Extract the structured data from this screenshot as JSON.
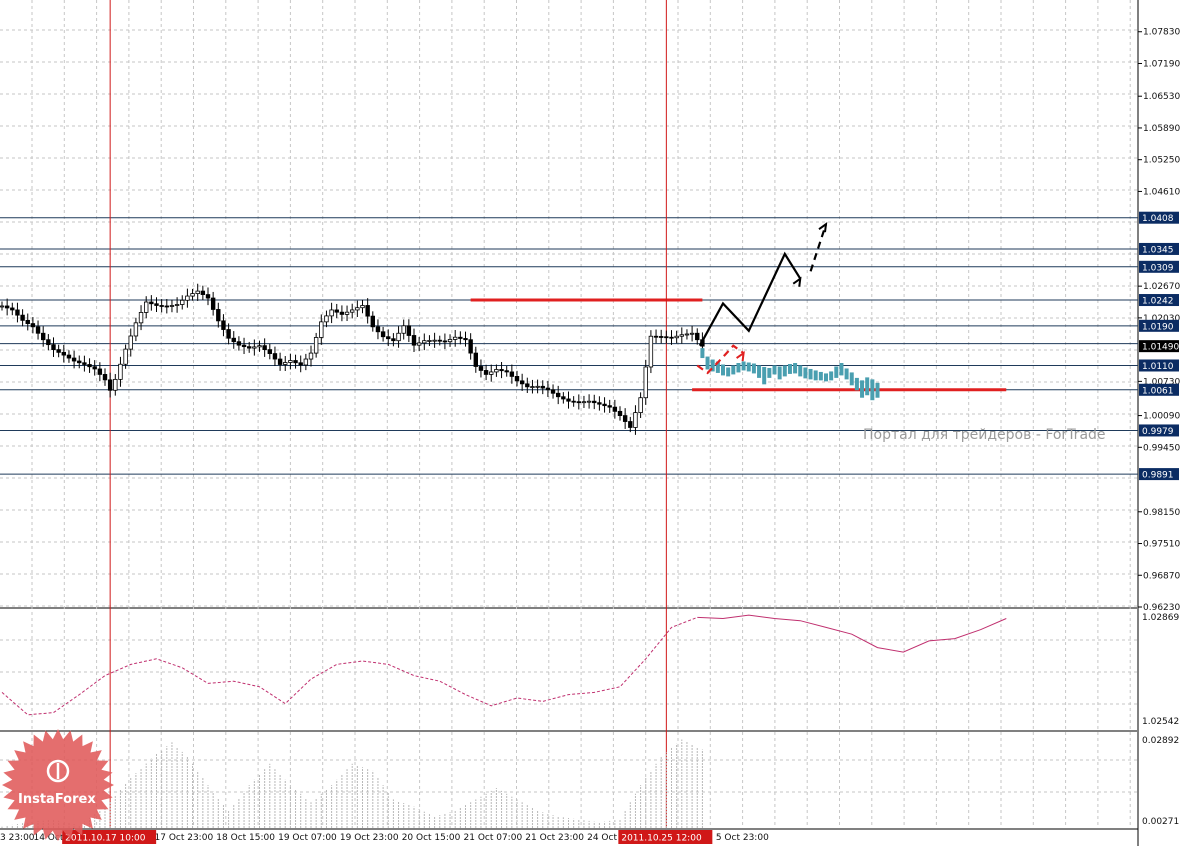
{
  "chart_data": {
    "type": "candlestick",
    "symbol_hint": "",
    "main_pane": {
      "ylim": [
        0.9623,
        1.0847
      ],
      "price_ticks": [
        1.0783,
        1.0719,
        1.0653,
        1.0589,
        1.0525,
        1.0461,
        1.027,
        1.0206,
        1.0078,
        1.0009,
        0.9945,
        0.9815,
        0.9751,
        0.9687,
        0.9623
      ],
      "price_tick_labels": [
        "1.07830",
        "1.07190",
        "1.06530",
        "1.05890",
        "1.05250",
        "1.04610",
        "1.02670",
        "1.02030",
        "1.00730",
        "1.00090",
        "0.99450",
        "0.98150",
        "0.97510",
        "0.96870",
        "0.96230"
      ],
      "current_price": {
        "value": 1.0149,
        "label": "1.01490"
      },
      "horizontal_levels": [
        {
          "value": 1.0408,
          "label": "1.0408"
        },
        {
          "value": 1.0345,
          "label": "1.0345"
        },
        {
          "value": 1.0309,
          "label": "1.0309"
        },
        {
          "value": 1.0242,
          "label": "1.0242"
        },
        {
          "value": 1.019,
          "label": "1.0190"
        },
        {
          "value": 1.011,
          "label": "1.0110"
        },
        {
          "value": 1.0061,
          "label": "1.0061"
        },
        {
          "value": 0.9979,
          "label": "0.9979"
        },
        {
          "value": 0.9891,
          "label": "0.9891"
        }
      ],
      "extra_unlabeled_level": 1.0154,
      "red_segments": [
        {
          "value": 1.0242,
          "from_bar": 91,
          "to_bar": 136
        },
        {
          "value": 1.0061,
          "from_bar": 134,
          "to_bar": 195
        }
      ],
      "close_path": [
        [
          0,
          1.023
        ],
        [
          2,
          1.0222
        ],
        [
          4,
          1.0201
        ],
        [
          6,
          1.0188
        ],
        [
          8,
          1.0162
        ],
        [
          10,
          1.0142
        ],
        [
          12,
          1.0131
        ],
        [
          14,
          1.0119
        ],
        [
          16,
          1.0112
        ],
        [
          18,
          1.0103
        ],
        [
          20,
          1.0081
        ],
        [
          21,
          1.006
        ],
        [
          22,
          1.0082
        ],
        [
          24,
          1.0143
        ],
        [
          26,
          1.0196
        ],
        [
          28,
          1.0238
        ],
        [
          30,
          1.0231
        ],
        [
          32,
          1.0229
        ],
        [
          34,
          1.0233
        ],
        [
          36,
          1.025
        ],
        [
          38,
          1.026
        ],
        [
          40,
          1.0246
        ],
        [
          42,
          1.02
        ],
        [
          44,
          1.0165
        ],
        [
          46,
          1.0151
        ],
        [
          48,
          1.0145
        ],
        [
          50,
          1.015
        ],
        [
          52,
          1.0134
        ],
        [
          54,
          1.0112
        ],
        [
          56,
          1.012
        ],
        [
          58,
          1.0111
        ],
        [
          60,
          1.0135
        ],
        [
          62,
          1.0198
        ],
        [
          64,
          1.0222
        ],
        [
          66,
          1.0213
        ],
        [
          68,
          1.0222
        ],
        [
          70,
          1.0231
        ],
        [
          72,
          1.0188
        ],
        [
          74,
          1.0168
        ],
        [
          76,
          1.016
        ],
        [
          78,
          1.019
        ],
        [
          80,
          1.0151
        ],
        [
          82,
          1.016
        ],
        [
          84,
          1.0161
        ],
        [
          86,
          1.0158
        ],
        [
          88,
          1.0167
        ],
        [
          90,
          1.0162
        ],
        [
          92,
          1.0108
        ],
        [
          94,
          1.0092
        ],
        [
          96,
          1.0102
        ],
        [
          98,
          1.0097
        ],
        [
          100,
          1.0079
        ],
        [
          102,
          1.0067
        ],
        [
          104,
          1.0068
        ],
        [
          106,
          1.0061
        ],
        [
          108,
          1.0047
        ],
        [
          110,
          1.0038
        ],
        [
          112,
          1.0036
        ],
        [
          114,
          1.0038
        ],
        [
          116,
          1.0032
        ],
        [
          118,
          1.0026
        ],
        [
          120,
          1.0009
        ],
        [
          122,
          0.9985
        ],
        [
          124,
          1.0045
        ],
        [
          126,
          1.0169
        ],
        [
          128,
          1.0168
        ],
        [
          130,
          1.0166
        ],
        [
          132,
          1.0172
        ],
        [
          134,
          1.0175
        ],
        [
          136,
          1.0149
        ]
      ],
      "forecast_bars": [
        [
          136,
          1.0145,
          1.0125
        ],
        [
          137,
          1.0128,
          1.0102
        ],
        [
          138,
          1.0122,
          1.0098
        ],
        [
          139,
          1.0118,
          1.0095
        ],
        [
          140,
          1.0112,
          1.009
        ],
        [
          141,
          1.0106,
          1.0088
        ],
        [
          142,
          1.011,
          1.0092
        ],
        [
          143,
          1.0115,
          1.0096
        ],
        [
          144,
          1.0118,
          1.01
        ],
        [
          145,
          1.0116,
          1.0098
        ],
        [
          146,
          1.0114,
          1.0094
        ],
        [
          147,
          1.011,
          1.0085
        ],
        [
          148,
          1.0107,
          1.0072
        ],
        [
          149,
          1.0105,
          1.0085
        ],
        [
          150,
          1.011,
          1.0092
        ],
        [
          151,
          1.0108,
          1.0082
        ],
        [
          152,
          1.011,
          1.0088
        ],
        [
          153,
          1.0113,
          1.0093
        ],
        [
          154,
          1.0115,
          1.0094
        ],
        [
          155,
          1.011,
          1.0088
        ],
        [
          156,
          1.0106,
          1.0084
        ],
        [
          157,
          1.0103,
          1.0082
        ],
        [
          158,
          1.01,
          1.008
        ],
        [
          159,
          1.0097,
          1.008
        ],
        [
          160,
          1.0094,
          1.0078
        ],
        [
          161,
          1.0098,
          1.008
        ],
        [
          162,
          1.0108,
          1.0085
        ],
        [
          163,
          1.0115,
          1.009
        ],
        [
          164,
          1.0104,
          1.0082
        ],
        [
          165,
          1.0096,
          1.007
        ],
        [
          166,
          1.0085,
          1.006
        ],
        [
          167,
          1.008,
          1.0045
        ],
        [
          168,
          1.0086,
          1.005
        ],
        [
          169,
          1.0082,
          1.004
        ],
        [
          170,
          1.0075,
          1.0045
        ]
      ],
      "drawings": [
        {
          "type": "polyline",
          "color": "#000000",
          "dashed": false,
          "points": [
            [
              135.5,
              1.015
            ],
            [
              140,
              1.0235
            ],
            [
              145,
              1.018
            ],
            [
              152,
              1.0335
            ],
            [
              155,
              1.0285
            ]
          ]
        },
        {
          "type": "polyline",
          "color": "#000000",
          "dashed": true,
          "points": [
            [
              157,
              1.03
            ],
            [
              160,
              1.0395
            ]
          ]
        },
        {
          "type": "polyline",
          "color": "#e02020",
          "dashed": true,
          "points": [
            [
              135,
              1.011
            ],
            [
              137,
              1.0095
            ],
            [
              140,
              1.0127
            ],
            [
              142,
              1.015
            ],
            [
              144,
              1.0135
            ]
          ]
        }
      ]
    },
    "indicator_pane_1": {
      "ylim": [
        1.02542,
        1.02869
      ],
      "tick_labels": [
        "1.02869",
        "1.02542"
      ],
      "series_color": "#c0306f",
      "points": [
        [
          0,
          0.3
        ],
        [
          5,
          0.1
        ],
        [
          10,
          0.12
        ],
        [
          15,
          0.28
        ],
        [
          20,
          0.45
        ],
        [
          25,
          0.55
        ],
        [
          30,
          0.6
        ],
        [
          35,
          0.52
        ],
        [
          40,
          0.38
        ],
        [
          45,
          0.4
        ],
        [
          50,
          0.35
        ],
        [
          55,
          0.2
        ],
        [
          60,
          0.42
        ],
        [
          65,
          0.55
        ],
        [
          70,
          0.58
        ],
        [
          75,
          0.55
        ],
        [
          80,
          0.45
        ],
        [
          85,
          0.4
        ],
        [
          90,
          0.28
        ],
        [
          95,
          0.18
        ],
        [
          100,
          0.25
        ],
        [
          105,
          0.22
        ],
        [
          110,
          0.28
        ],
        [
          115,
          0.3
        ],
        [
          120,
          0.35
        ],
        [
          125,
          0.6
        ],
        [
          130,
          0.88
        ],
        [
          135,
          0.97
        ],
        [
          140,
          0.96
        ],
        [
          145,
          0.99
        ],
        [
          150,
          0.96
        ],
        [
          155,
          0.94
        ],
        [
          160,
          0.88
        ],
        [
          165,
          0.82
        ],
        [
          170,
          0.7
        ],
        [
          175,
          0.66
        ],
        [
          180,
          0.76
        ],
        [
          185,
          0.78
        ],
        [
          190,
          0.86
        ],
        [
          195,
          0.96
        ]
      ],
      "solid_from_bar": 136
    },
    "indicator_pane_2": {
      "ylim": [
        0.00271,
        0.02892
      ],
      "tick_labels": [
        "0.02892",
        "0.00271"
      ],
      "series_color": "#b8b8b8",
      "bars": [
        [
          0,
          0.001
        ],
        [
          5,
          0.004
        ],
        [
          10,
          0.006
        ],
        [
          15,
          0.002
        ],
        [
          20,
          0.015
        ],
        [
          25,
          0.035
        ],
        [
          30,
          0.052
        ],
        [
          33,
          0.06
        ],
        [
          36,
          0.05
        ],
        [
          40,
          0.03
        ],
        [
          44,
          0.012
        ],
        [
          48,
          0.03
        ],
        [
          52,
          0.045
        ],
        [
          56,
          0.03
        ],
        [
          60,
          0.018
        ],
        [
          64,
          0.03
        ],
        [
          68,
          0.045
        ],
        [
          72,
          0.04
        ],
        [
          76,
          0.02
        ],
        [
          80,
          0.015
        ],
        [
          84,
          0.008
        ],
        [
          88,
          0.012
        ],
        [
          92,
          0.02
        ],
        [
          96,
          0.028
        ],
        [
          100,
          0.02
        ],
        [
          104,
          0.012
        ],
        [
          108,
          0.008
        ],
        [
          112,
          0.006
        ],
        [
          116,
          0.004
        ],
        [
          120,
          0.006
        ],
        [
          124,
          0.03
        ],
        [
          128,
          0.05
        ],
        [
          132,
          0.062
        ],
        [
          136,
          0.055
        ]
      ]
    },
    "time_labels": [
      {
        "bar": 0,
        "label": "3 23:00"
      },
      {
        "bar": 6.5,
        "label": "14 Oct"
      },
      {
        "bar": 30,
        "label": "17 Oct 23:00"
      },
      {
        "bar": 42,
        "label": "18 Oct 15:00"
      },
      {
        "bar": 54,
        "label": "19 Oct 07:00"
      },
      {
        "bar": 66,
        "label": "19 Oct 23:00"
      },
      {
        "bar": 78,
        "label": "20 Oct 15:00"
      },
      {
        "bar": 90,
        "label": "21 Oct 07:00"
      },
      {
        "bar": 102,
        "label": "21 Oct 23:00"
      },
      {
        "bar": 114,
        "label": "24 Oct 1"
      },
      {
        "bar": 139,
        "label": "5 Oct 23:00"
      }
    ],
    "vertical_markers": [
      {
        "bar": 21,
        "label": "2011.10.17 10:00"
      },
      {
        "bar": 129,
        "label": "2011.10.25 12:00"
      }
    ],
    "grid": true,
    "watermark": "Портал для трейдеров - ForTrade",
    "logo_text": "InstaForex"
  },
  "colors": {
    "level_line": "#1f3a5a",
    "price_box": "#0b2c63",
    "current_box": "#000000",
    "red_line": "#e02020",
    "marker_box": "#d01818",
    "forecast": "#4a9fb0",
    "candle": "#000000",
    "grid": "#c6c6c6",
    "logo": "#e05a5a"
  }
}
